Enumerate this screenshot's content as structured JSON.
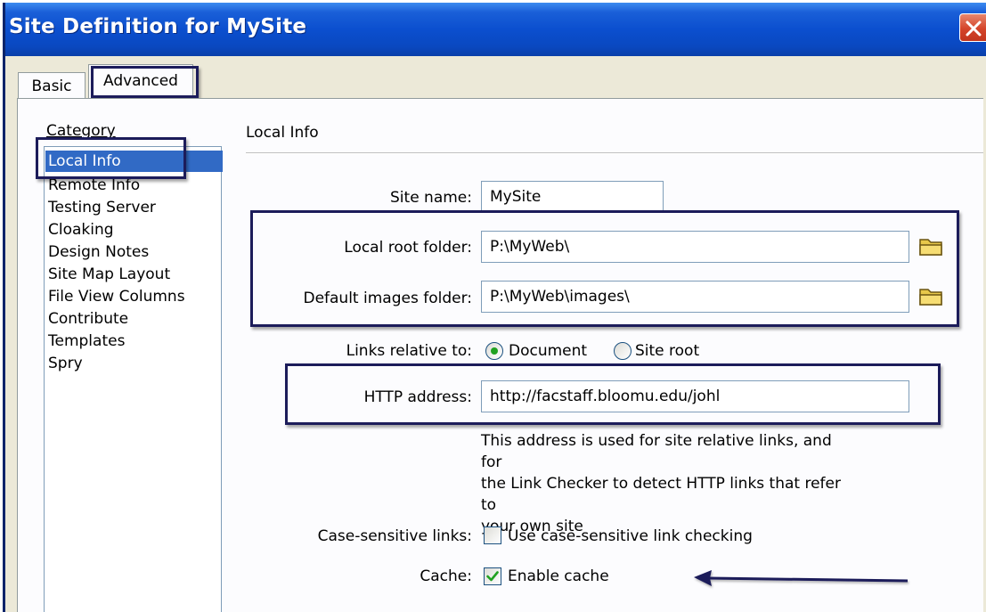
{
  "window": {
    "title": "Site Definition for MySite"
  },
  "tabs": [
    {
      "label": "Basic"
    },
    {
      "label": "Advanced"
    }
  ],
  "category": {
    "label": "Category",
    "items": [
      {
        "label": "Local Info",
        "selected": true
      },
      {
        "label": "Remote Info"
      },
      {
        "label": "Testing Server"
      },
      {
        "label": "Cloaking"
      },
      {
        "label": "Design Notes"
      },
      {
        "label": "Site Map Layout"
      },
      {
        "label": "File View Columns"
      },
      {
        "label": "Contribute"
      },
      {
        "label": "Templates"
      },
      {
        "label": "Spry"
      }
    ]
  },
  "local_info": {
    "section_title": "Local Info",
    "site_name_label": "Site name:",
    "site_name_value": "MySite",
    "local_root_label": "Local root folder:",
    "local_root_value": "P:\\MyWeb\\",
    "default_images_label": "Default images folder:",
    "default_images_value": "P:\\MyWeb\\images\\",
    "links_relative_label": "Links relative to:",
    "links_option_document": "Document",
    "links_option_site_root": "Site root",
    "links_selected": "Document",
    "http_label": "HTTP address:",
    "http_value": "http://facstaff.bloomu.edu/johl",
    "http_help_line1": "This address is used for site relative links, and for",
    "http_help_line2": "the Link Checker to detect HTTP links that refer to",
    "http_help_line3": "your own site",
    "case_label": "Case-sensitive links:",
    "case_checkbox_text": "Use case-sensitive link checking",
    "case_checked": false,
    "cache_label": "Cache:",
    "cache_checkbox_text": "Enable cache",
    "cache_checked": true
  },
  "colors": {
    "title_bar": "#0b4fcf",
    "selection": "#316ac5",
    "highlight_box": "#1c1c5a",
    "radio_dot": "#21a121",
    "check_mark": "#21a121"
  },
  "icons": [
    "close-icon",
    "folder-icon",
    "arrow-left-icon"
  ]
}
